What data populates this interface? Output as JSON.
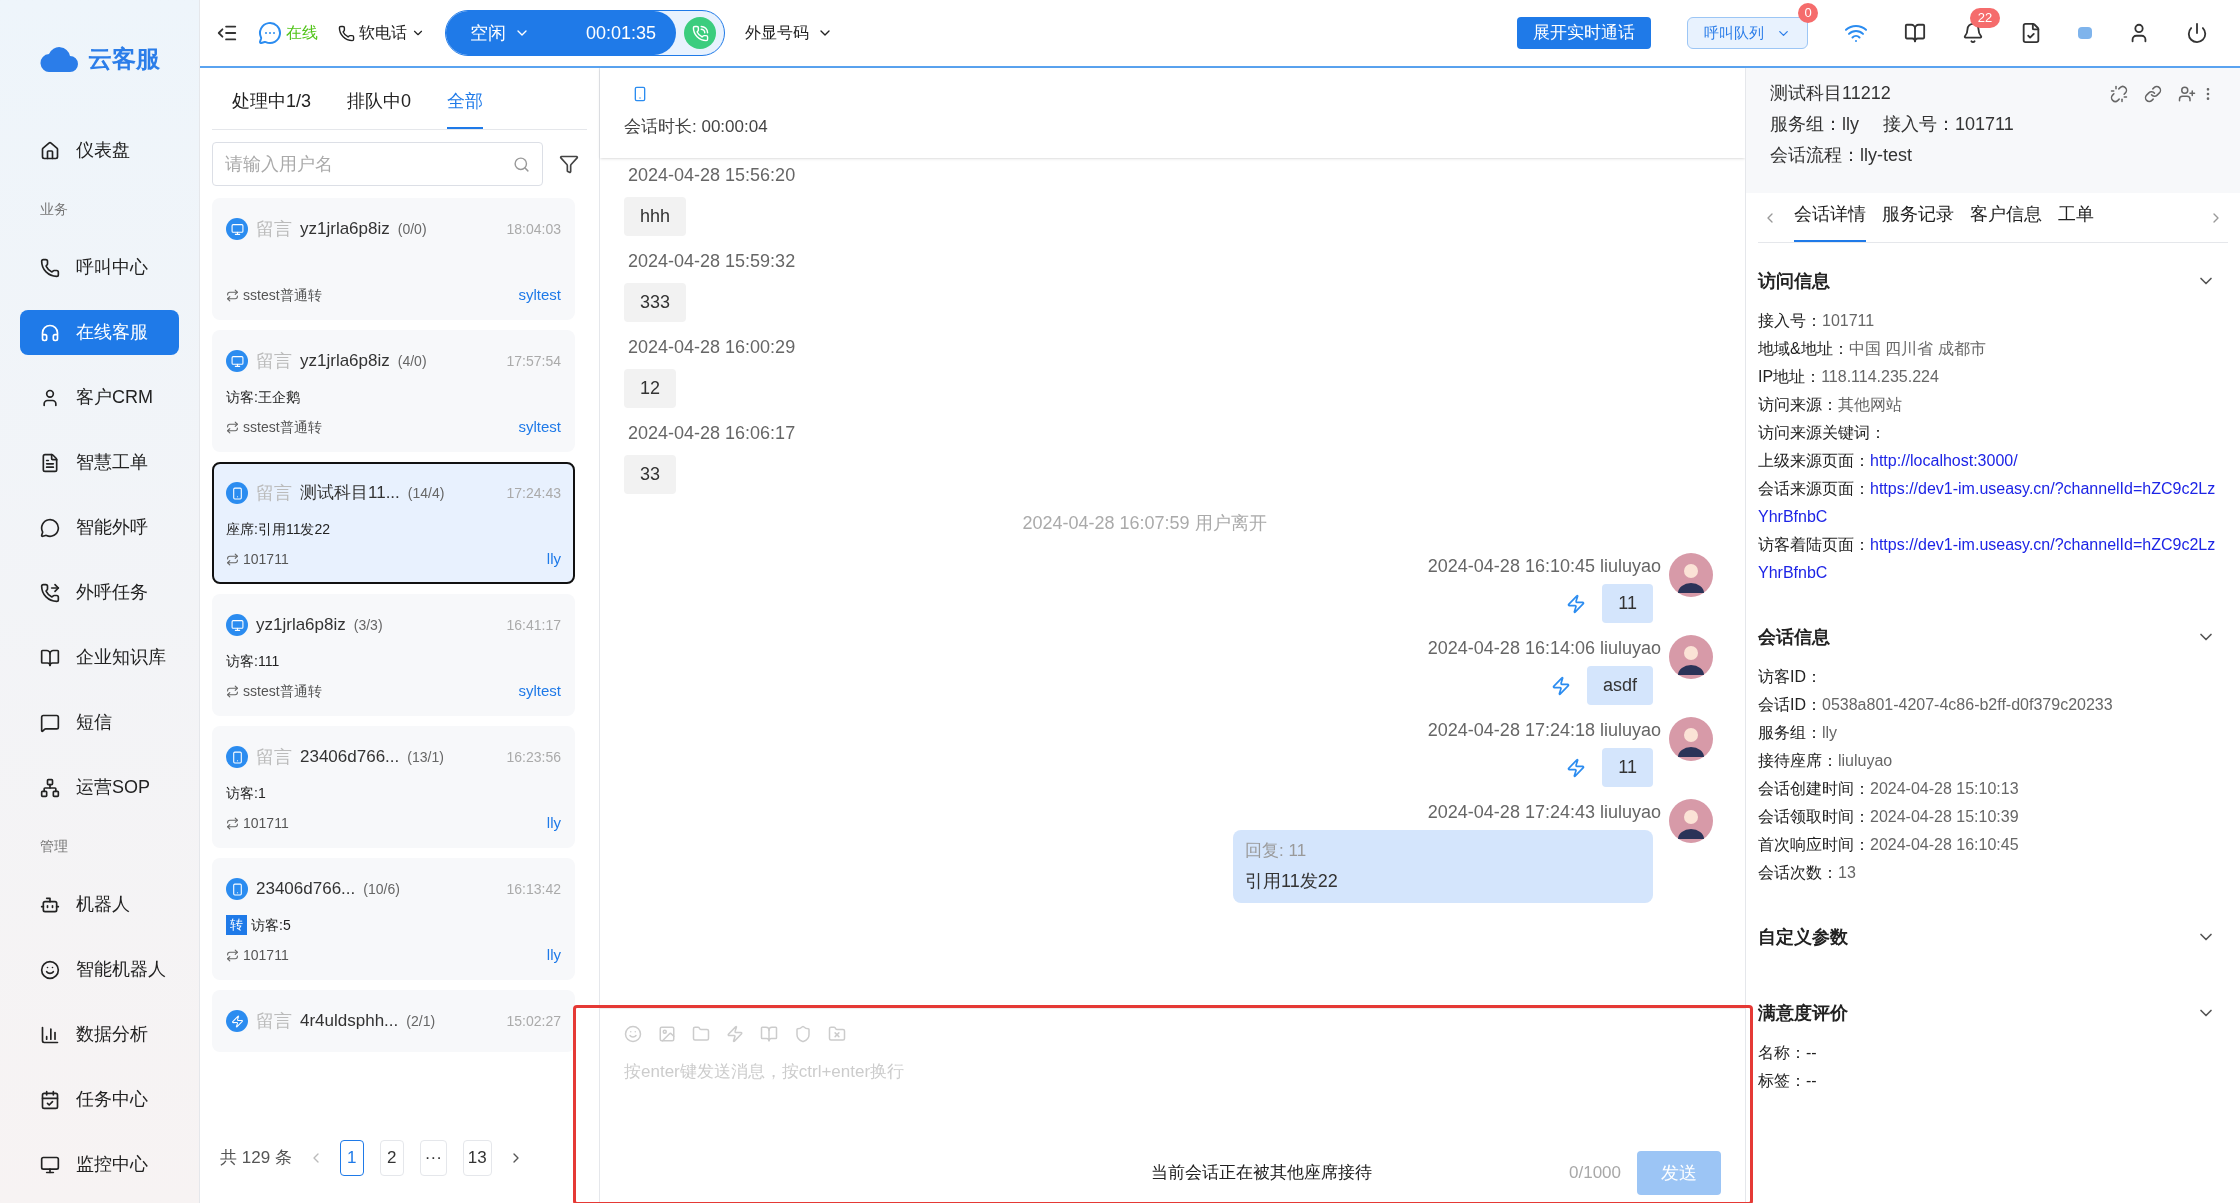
{
  "brand": {
    "name": "云客服"
  },
  "sidebar": {
    "items": [
      {
        "kind": "item",
        "label": "仪表盘",
        "selected": false
      },
      {
        "kind": "section",
        "label": "业务"
      },
      {
        "kind": "item",
        "label": "呼叫中心",
        "selected": false
      },
      {
        "kind": "item",
        "label": "在线客服",
        "selected": true
      },
      {
        "kind": "item",
        "label": "客户CRM",
        "selected": false
      },
      {
        "kind": "item",
        "label": "智慧工单",
        "selected": false
      },
      {
        "kind": "item",
        "label": "智能外呼",
        "selected": false
      },
      {
        "kind": "item",
        "label": "外呼任务",
        "selected": false
      },
      {
        "kind": "item",
        "label": "企业知识库",
        "selected": false
      },
      {
        "kind": "item",
        "label": "短信",
        "selected": false
      },
      {
        "kind": "item",
        "label": "运营SOP",
        "selected": false
      },
      {
        "kind": "section",
        "label": "管理"
      },
      {
        "kind": "item",
        "label": "机器人",
        "selected": false
      },
      {
        "kind": "item",
        "label": "智能机器人",
        "selected": false
      },
      {
        "kind": "item",
        "label": "数据分析",
        "selected": false
      },
      {
        "kind": "item",
        "label": "任务中心",
        "selected": false
      },
      {
        "kind": "item",
        "label": "监控中心",
        "selected": false
      }
    ]
  },
  "topbar": {
    "status": "在线",
    "phone_mode": "软电话",
    "call_state": "空闲",
    "call_timer": "00:01:35",
    "caller_id": "外显号码",
    "live_call_button": "展开实时通话",
    "queue": "呼叫队列",
    "queue_badge": "0",
    "notification_badge": "22"
  },
  "conversation_list": {
    "tabs": [
      {
        "label": "处理中1/3",
        "selected": false
      },
      {
        "label": "排队中0",
        "selected": false
      },
      {
        "label": "全部",
        "selected": true
      }
    ],
    "search": {
      "placeholder": "请输入用户名"
    },
    "items": [
      {
        "kind": "pc",
        "tag": "留言",
        "name": "yz1jrla6p8iz",
        "count": "(0/0)",
        "time": "18:04:03",
        "route": "sstest普通转",
        "agent": "syltest",
        "selected": false
      },
      {
        "kind": "pc",
        "tag": "留言",
        "name": "yz1jrla6p8iz",
        "count": "(4/0)",
        "time": "17:57:54",
        "preview": "访客:王企鹅",
        "route": "sstest普通转",
        "agent": "syltest",
        "selected": false
      },
      {
        "kind": "mobile",
        "tag": "留言",
        "name": "测试科目11...",
        "count": "(14/4)",
        "time": "17:24:43",
        "preview": "座席:引用11发22",
        "route": "101711",
        "agent": "lly",
        "selected": true
      },
      {
        "kind": "pc",
        "name": "yz1jrla6p8iz",
        "count": "(3/3)",
        "time": "16:41:17",
        "preview": "访客:111",
        "route": "sstest普通转",
        "agent": "syltest",
        "selected": false
      },
      {
        "kind": "mobile",
        "tag": "留言",
        "name": "23406d766...",
        "count": "(13/1)",
        "time": "16:23:56",
        "preview": "访客:1",
        "route": "101711",
        "agent": "lly",
        "selected": false
      },
      {
        "kind": "mobile",
        "name": "23406d766...",
        "count": "(10/6)",
        "time": "16:13:42",
        "badge": "转",
        "preview": "访客:5",
        "route": "101711",
        "agent": "lly",
        "selected": false
      },
      {
        "kind": "app",
        "tag": "留言",
        "name": "4r4uldsphh...",
        "count": "(2/1)",
        "time": "15:02:27",
        "selected": false
      }
    ],
    "pagination": {
      "total": "共 129 条",
      "pages": [
        {
          "label": "1",
          "selected": true
        },
        {
          "label": "2",
          "selected": false
        },
        {
          "label": "···",
          "selected": false
        },
        {
          "label": "13",
          "selected": false
        }
      ]
    }
  },
  "chat": {
    "duration": "会话时长: 00:00:04",
    "messages": [
      {
        "kind": "visitor",
        "time": "2024-04-28 15:56:20",
        "text": "hhh"
      },
      {
        "kind": "visitor",
        "time": "2024-04-28 15:59:32",
        "text": "333"
      },
      {
        "kind": "visitor",
        "time": "2024-04-28 16:00:29",
        "text": "12"
      },
      {
        "kind": "visitor",
        "time": "2024-04-28 16:06:17",
        "text": "33"
      },
      {
        "kind": "system",
        "text": "2024-04-28 16:07:59 用户离开"
      },
      {
        "kind": "agent",
        "time": "2024-04-28 16:10:45 liuluyao",
        "text": "11"
      },
      {
        "kind": "agent",
        "time": "2024-04-28 16:14:06 liuluyao",
        "text": "asdf"
      },
      {
        "kind": "agent",
        "time": "2024-04-28 17:24:18 liuluyao",
        "text": "11"
      },
      {
        "kind": "agent",
        "time": "2024-04-28 17:24:43 liuluyao",
        "quote": "回复: 11",
        "text": "引用11发22"
      }
    ],
    "composer": {
      "placeholder": "按enter键发送消息，按ctrl+enter换行",
      "notice": "当前会话正在被其他座席接待",
      "counter": "0/1000",
      "send": "发送",
      "disabled": true
    }
  },
  "detail": {
    "title": "测试科目11212",
    "service_group": "服务组：lly",
    "access_no": "接入号：101711",
    "flow": "会话流程：lly-test",
    "tabs": [
      {
        "label": "会话详情",
        "selected": true
      },
      {
        "label": "服务记录",
        "selected": false
      },
      {
        "label": "客户信息",
        "selected": false
      },
      {
        "label": "工单",
        "selected": false
      }
    ],
    "sections": [
      {
        "title": "访问信息",
        "fields": [
          {
            "label": "接入号：",
            "value": "101711"
          },
          {
            "label": "地域&地址：",
            "value": "中国 四川省 成都市"
          },
          {
            "label": "IP地址：",
            "value": "118.114.235.224"
          },
          {
            "label": "访问来源：",
            "value": "其他网站"
          },
          {
            "label": "访问来源关键词："
          },
          {
            "label": "上级来源页面：",
            "value": "http://localhost:3000/",
            "link": true
          },
          {
            "label": "会话来源页面：",
            "value": "https://dev1-im.useasy.cn/?channelId=hZC9c2LzYhrBfnbC",
            "link": true
          },
          {
            "label": "访客着陆页面：",
            "value": "https://dev1-im.useasy.cn/?channelId=hZC9c2LzYhrBfnbC",
            "link": true
          }
        ]
      },
      {
        "title": "会话信息",
        "fields": [
          {
            "label": "访客ID："
          },
          {
            "label": "会话ID：",
            "value": "0538a801-4207-4c86-b2ff-d0f379c20233"
          },
          {
            "label": "服务组：",
            "value": "lly"
          },
          {
            "label": "接待座席：",
            "value": "liuluyao"
          },
          {
            "label": "会话创建时间：",
            "value": "2024-04-28 15:10:13"
          },
          {
            "label": "会话领取时间：",
            "value": "2024-04-28 15:10:39"
          },
          {
            "label": "首次响应时间：",
            "value": "2024-04-28 16:10:45"
          },
          {
            "label": "会话次数：",
            "value": "13"
          }
        ]
      },
      {
        "title": "自定义参数"
      },
      {
        "title": "满意度评价",
        "fields": [
          {
            "text": "名称：--"
          },
          {
            "text": "标签：--"
          }
        ]
      }
    ]
  }
}
